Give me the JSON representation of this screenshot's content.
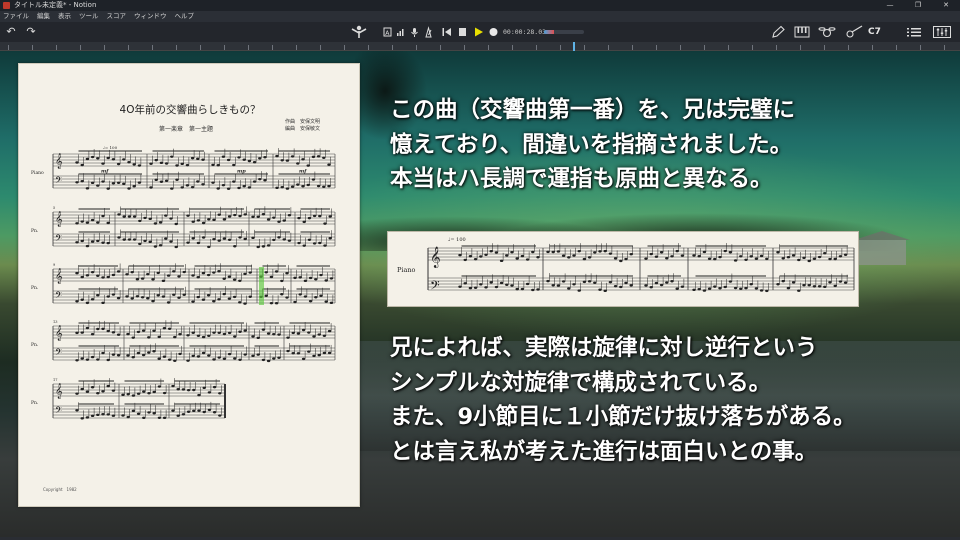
{
  "window": {
    "title": "タイトル未定義* - Notion",
    "controls": [
      "—",
      "❐",
      "✕"
    ]
  },
  "menu": {
    "items": [
      "ファイル",
      "編集",
      "表示",
      "ツール",
      "スコア",
      "ウィンドウ",
      "ヘルプ"
    ]
  },
  "toolbar": {
    "undo_icon": "↶",
    "redo_icon": "↷",
    "conductor_icon": "conductor-icon",
    "time_display": "00:00:28.03",
    "level_fraction": 0.25,
    "chord_label": "C7",
    "play_color": "#e8e000"
  },
  "score": {
    "title": "4O年前の交響曲らしきもの？",
    "subtitle": "第一楽章　第一主題",
    "credit_line1": "作曲　安保文明",
    "credit_line2": "編曲　安保敏文",
    "tempo_mark": "♩= 100",
    "instrument_first": "Piano",
    "instrument_short": "Pn.",
    "copyright": "Copyright　1982",
    "measure_numbers": [
      "5",
      "9",
      "13",
      "17"
    ],
    "dynamics": [
      "mf",
      "mp",
      "mf"
    ]
  },
  "caption_top": {
    "lines": [
      "この曲（交響曲第一番）を、兄は完璧に",
      "憶えており、間違いを指摘されました。",
      "本当はハ長調で運指も原曲と異なる。"
    ]
  },
  "excerpt": {
    "instrument": "Piano",
    "tempo_mark": "♩= 100"
  },
  "caption_bottom": {
    "lines": [
      "兄によれば、実際は旋律に対し逆行という",
      "シンプルな対旋律で構成されている。",
      "また、9小節目に１小節だけ抜け落ちがある。",
      "とは言え私が考えた進行は面白いとの事。"
    ]
  }
}
